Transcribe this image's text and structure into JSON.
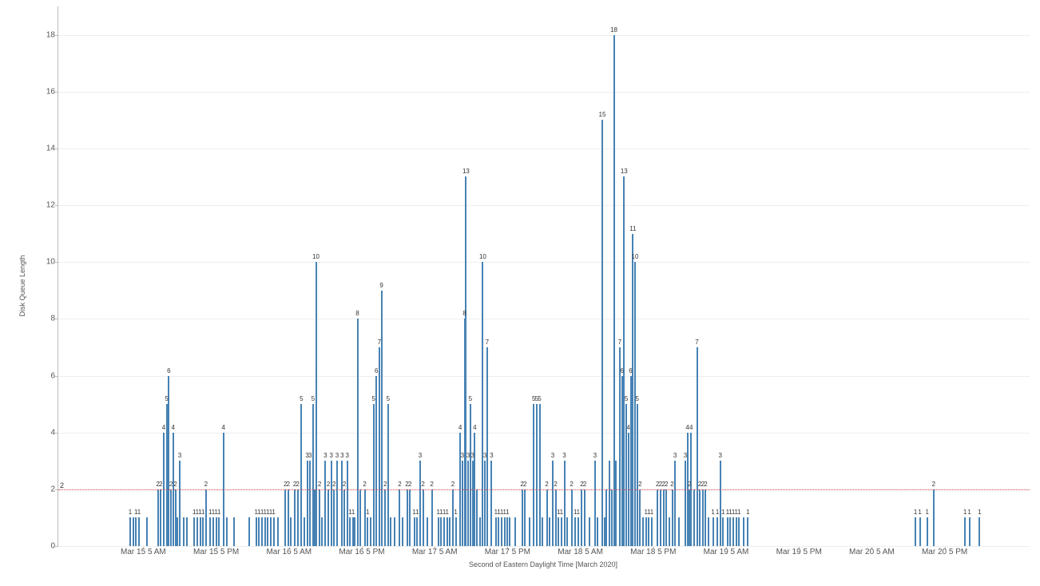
{
  "chart_data": {
    "type": "bar",
    "ylabel": "Disk Queue Length",
    "xlabel": "Second of Eastern Daylight Time [March 2020]",
    "ylim": [
      0,
      19
    ],
    "yticks": [
      0,
      2,
      4,
      6,
      8,
      10,
      12,
      14,
      16,
      18
    ],
    "x_categories": [
      "Mar 15 5 AM",
      "Mar 15 5 PM",
      "Mar 16 5 AM",
      "Mar 16 5 PM",
      "Mar 17 5 AM",
      "Mar 17 5 PM",
      "Mar 18 5 AM",
      "Mar 18 5 PM",
      "Mar 19 5 AM",
      "Mar 19 5 PM",
      "Mar 20 5 AM",
      "Mar 20 5 PM"
    ],
    "reference_line": {
      "y": 2,
      "label": "2"
    },
    "bars": [
      {
        "x": 0.32,
        "y": 1,
        "l": "1"
      },
      {
        "x": 0.36,
        "y": 1,
        "l": ""
      },
      {
        "x": 0.4,
        "y": 1,
        "l": "1"
      },
      {
        "x": 0.44,
        "y": 1,
        "l": "1"
      },
      {
        "x": 0.55,
        "y": 1,
        "l": ""
      },
      {
        "x": 0.7,
        "y": 2,
        "l": "2"
      },
      {
        "x": 0.74,
        "y": 2,
        "l": "2"
      },
      {
        "x": 0.78,
        "y": 4,
        "l": "4"
      },
      {
        "x": 0.82,
        "y": 5,
        "l": "5"
      },
      {
        "x": 0.85,
        "y": 6,
        "l": "6"
      },
      {
        "x": 0.88,
        "y": 2,
        "l": "2"
      },
      {
        "x": 0.91,
        "y": 4,
        "l": "4"
      },
      {
        "x": 0.94,
        "y": 2,
        "l": "2"
      },
      {
        "x": 0.97,
        "y": 1,
        "l": ""
      },
      {
        "x": 1.0,
        "y": 3,
        "l": "3"
      },
      {
        "x": 1.05,
        "y": 1,
        "l": ""
      },
      {
        "x": 1.1,
        "y": 1,
        "l": ""
      },
      {
        "x": 1.2,
        "y": 1,
        "l": "1"
      },
      {
        "x": 1.24,
        "y": 1,
        "l": "1"
      },
      {
        "x": 1.28,
        "y": 1,
        "l": "1"
      },
      {
        "x": 1.32,
        "y": 1,
        "l": "1"
      },
      {
        "x": 1.36,
        "y": 2,
        "l": "2"
      },
      {
        "x": 1.42,
        "y": 1,
        "l": "1"
      },
      {
        "x": 1.46,
        "y": 1,
        "l": "1"
      },
      {
        "x": 1.5,
        "y": 1,
        "l": "1"
      },
      {
        "x": 1.54,
        "y": 1,
        "l": "1"
      },
      {
        "x": 1.6,
        "y": 4,
        "l": "4"
      },
      {
        "x": 1.65,
        "y": 1,
        "l": ""
      },
      {
        "x": 1.75,
        "y": 1,
        "l": ""
      },
      {
        "x": 1.95,
        "y": 1,
        "l": ""
      },
      {
        "x": 2.05,
        "y": 1,
        "l": "1"
      },
      {
        "x": 2.09,
        "y": 1,
        "l": "1"
      },
      {
        "x": 2.13,
        "y": 1,
        "l": "1"
      },
      {
        "x": 2.17,
        "y": 1,
        "l": "1"
      },
      {
        "x": 2.21,
        "y": 1,
        "l": "1"
      },
      {
        "x": 2.25,
        "y": 1,
        "l": "1"
      },
      {
        "x": 2.29,
        "y": 1,
        "l": "1"
      },
      {
        "x": 2.35,
        "y": 1,
        "l": ""
      },
      {
        "x": 2.45,
        "y": 2,
        "l": "2"
      },
      {
        "x": 2.49,
        "y": 2,
        "l": "2"
      },
      {
        "x": 2.52,
        "y": 1,
        "l": ""
      },
      {
        "x": 2.58,
        "y": 2,
        "l": "2"
      },
      {
        "x": 2.62,
        "y": 2,
        "l": "2"
      },
      {
        "x": 2.67,
        "y": 5,
        "l": "5"
      },
      {
        "x": 2.71,
        "y": 1,
        "l": ""
      },
      {
        "x": 2.75,
        "y": 3,
        "l": "3"
      },
      {
        "x": 2.79,
        "y": 3,
        "l": "3"
      },
      {
        "x": 2.83,
        "y": 5,
        "l": "5"
      },
      {
        "x": 2.85,
        "y": 2,
        "l": ""
      },
      {
        "x": 2.87,
        "y": 10,
        "l": "10"
      },
      {
        "x": 2.92,
        "y": 2,
        "l": "2"
      },
      {
        "x": 2.95,
        "y": 1,
        "l": ""
      },
      {
        "x": 3.0,
        "y": 3,
        "l": "3"
      },
      {
        "x": 3.04,
        "y": 2,
        "l": "2"
      },
      {
        "x": 3.08,
        "y": 3,
        "l": "3"
      },
      {
        "x": 3.12,
        "y": 2,
        "l": "2"
      },
      {
        "x": 3.16,
        "y": 3,
        "l": "3"
      },
      {
        "x": 3.23,
        "y": 3,
        "l": "3"
      },
      {
        "x": 3.26,
        "y": 2,
        "l": "2"
      },
      {
        "x": 3.3,
        "y": 3,
        "l": "3"
      },
      {
        "x": 3.34,
        "y": 1,
        "l": "1"
      },
      {
        "x": 3.38,
        "y": 1,
        "l": "1"
      },
      {
        "x": 3.4,
        "y": 1,
        "l": ""
      },
      {
        "x": 3.44,
        "y": 8,
        "l": "8"
      },
      {
        "x": 3.48,
        "y": 2,
        "l": ""
      },
      {
        "x": 3.54,
        "y": 2,
        "l": "2"
      },
      {
        "x": 3.58,
        "y": 1,
        "l": "1"
      },
      {
        "x": 3.62,
        "y": 1,
        "l": ""
      },
      {
        "x": 3.66,
        "y": 5,
        "l": "5"
      },
      {
        "x": 3.7,
        "y": 6,
        "l": "6"
      },
      {
        "x": 3.74,
        "y": 7,
        "l": "7"
      },
      {
        "x": 3.77,
        "y": 9,
        "l": "9"
      },
      {
        "x": 3.82,
        "y": 2,
        "l": "2"
      },
      {
        "x": 3.86,
        "y": 5,
        "l": "5"
      },
      {
        "x": 3.9,
        "y": 1,
        "l": ""
      },
      {
        "x": 3.95,
        "y": 1,
        "l": ""
      },
      {
        "x": 4.02,
        "y": 2,
        "l": "2"
      },
      {
        "x": 4.06,
        "y": 1,
        "l": ""
      },
      {
        "x": 4.12,
        "y": 2,
        "l": "2"
      },
      {
        "x": 4.16,
        "y": 2,
        "l": "2"
      },
      {
        "x": 4.22,
        "y": 1,
        "l": "1"
      },
      {
        "x": 4.26,
        "y": 1,
        "l": "1"
      },
      {
        "x": 4.3,
        "y": 3,
        "l": "3"
      },
      {
        "x": 4.34,
        "y": 2,
        "l": "2"
      },
      {
        "x": 4.4,
        "y": 1,
        "l": ""
      },
      {
        "x": 4.46,
        "y": 2,
        "l": "2"
      },
      {
        "x": 4.55,
        "y": 1,
        "l": "1"
      },
      {
        "x": 4.59,
        "y": 1,
        "l": "1"
      },
      {
        "x": 4.63,
        "y": 1,
        "l": "1"
      },
      {
        "x": 4.67,
        "y": 1,
        "l": "1"
      },
      {
        "x": 4.71,
        "y": 1,
        "l": ""
      },
      {
        "x": 4.75,
        "y": 2,
        "l": "2"
      },
      {
        "x": 4.79,
        "y": 1,
        "l": "1"
      },
      {
        "x": 4.85,
        "y": 4,
        "l": "4"
      },
      {
        "x": 4.88,
        "y": 3,
        "l": "3"
      },
      {
        "x": 4.91,
        "y": 8,
        "l": "8"
      },
      {
        "x": 4.93,
        "y": 13,
        "l": "13"
      },
      {
        "x": 4.96,
        "y": 3,
        "l": "3"
      },
      {
        "x": 4.99,
        "y": 5,
        "l": "5"
      },
      {
        "x": 5.02,
        "y": 3,
        "l": "3"
      },
      {
        "x": 5.05,
        "y": 4,
        "l": "4"
      },
      {
        "x": 5.08,
        "y": 2,
        "l": ""
      },
      {
        "x": 5.12,
        "y": 1,
        "l": ""
      },
      {
        "x": 5.16,
        "y": 10,
        "l": "10"
      },
      {
        "x": 5.19,
        "y": 3,
        "l": "3"
      },
      {
        "x": 5.22,
        "y": 7,
        "l": "7"
      },
      {
        "x": 5.28,
        "y": 3,
        "l": "3"
      },
      {
        "x": 5.34,
        "y": 1,
        "l": "1"
      },
      {
        "x": 5.38,
        "y": 1,
        "l": "1"
      },
      {
        "x": 5.42,
        "y": 1,
        "l": "1"
      },
      {
        "x": 5.46,
        "y": 1,
        "l": "1"
      },
      {
        "x": 5.5,
        "y": 1,
        "l": "1"
      },
      {
        "x": 5.53,
        "y": 1,
        "l": ""
      },
      {
        "x": 5.6,
        "y": 1,
        "l": ""
      },
      {
        "x": 5.7,
        "y": 2,
        "l": "2"
      },
      {
        "x": 5.74,
        "y": 2,
        "l": "2"
      },
      {
        "x": 5.8,
        "y": 1,
        "l": ""
      },
      {
        "x": 5.86,
        "y": 5,
        "l": "5"
      },
      {
        "x": 5.9,
        "y": 5,
        "l": "5"
      },
      {
        "x": 5.94,
        "y": 5,
        "l": "5"
      },
      {
        "x": 5.98,
        "y": 1,
        "l": ""
      },
      {
        "x": 6.04,
        "y": 2,
        "l": "2"
      },
      {
        "x": 6.08,
        "y": 1,
        "l": ""
      },
      {
        "x": 6.12,
        "y": 3,
        "l": "3"
      },
      {
        "x": 6.16,
        "y": 2,
        "l": "2"
      },
      {
        "x": 6.2,
        "y": 1,
        "l": "1"
      },
      {
        "x": 6.24,
        "y": 1,
        "l": "1"
      },
      {
        "x": 6.28,
        "y": 3,
        "l": "3"
      },
      {
        "x": 6.32,
        "y": 1,
        "l": ""
      },
      {
        "x": 6.38,
        "y": 2,
        "l": "2"
      },
      {
        "x": 6.43,
        "y": 1,
        "l": "1"
      },
      {
        "x": 6.47,
        "y": 1,
        "l": "1"
      },
      {
        "x": 6.52,
        "y": 2,
        "l": "2"
      },
      {
        "x": 6.56,
        "y": 2,
        "l": "2"
      },
      {
        "x": 6.62,
        "y": 1,
        "l": ""
      },
      {
        "x": 6.7,
        "y": 3,
        "l": "3"
      },
      {
        "x": 6.74,
        "y": 1,
        "l": ""
      },
      {
        "x": 6.8,
        "y": 15,
        "l": "15"
      },
      {
        "x": 6.83,
        "y": 1,
        "l": ""
      },
      {
        "x": 6.86,
        "y": 2,
        "l": ""
      },
      {
        "x": 6.9,
        "y": 3,
        "l": ""
      },
      {
        "x": 6.93,
        "y": 2,
        "l": ""
      },
      {
        "x": 6.96,
        "y": 18,
        "l": "18"
      },
      {
        "x": 6.99,
        "y": 3,
        "l": ""
      },
      {
        "x": 7.04,
        "y": 7,
        "l": "7"
      },
      {
        "x": 7.07,
        "y": 6,
        "l": "6"
      },
      {
        "x": 7.1,
        "y": 13,
        "l": "13"
      },
      {
        "x": 7.13,
        "y": 5,
        "l": "5"
      },
      {
        "x": 7.16,
        "y": 4,
        "l": "4"
      },
      {
        "x": 7.19,
        "y": 6,
        "l": "6"
      },
      {
        "x": 7.22,
        "y": 11,
        "l": "11"
      },
      {
        "x": 7.25,
        "y": 10,
        "l": "10"
      },
      {
        "x": 7.28,
        "y": 5,
        "l": "5"
      },
      {
        "x": 7.32,
        "y": 2,
        "l": "2"
      },
      {
        "x": 7.36,
        "y": 1,
        "l": ""
      },
      {
        "x": 7.4,
        "y": 1,
        "l": "1"
      },
      {
        "x": 7.44,
        "y": 1,
        "l": "1"
      },
      {
        "x": 7.48,
        "y": 1,
        "l": "1"
      },
      {
        "x": 7.56,
        "y": 2,
        "l": "2"
      },
      {
        "x": 7.6,
        "y": 2,
        "l": "2"
      },
      {
        "x": 7.64,
        "y": 2,
        "l": "2"
      },
      {
        "x": 7.68,
        "y": 2,
        "l": "2"
      },
      {
        "x": 7.72,
        "y": 1,
        "l": ""
      },
      {
        "x": 7.76,
        "y": 2,
        "l": "2"
      },
      {
        "x": 7.8,
        "y": 3,
        "l": "3"
      },
      {
        "x": 7.85,
        "y": 1,
        "l": ""
      },
      {
        "x": 7.94,
        "y": 3,
        "l": "3"
      },
      {
        "x": 7.97,
        "y": 4,
        "l": "4"
      },
      {
        "x": 8.0,
        "y": 2,
        "l": "2"
      },
      {
        "x": 8.02,
        "y": 4,
        "l": "4"
      },
      {
        "x": 8.06,
        "y": 2,
        "l": ""
      },
      {
        "x": 8.1,
        "y": 7,
        "l": "7"
      },
      {
        "x": 8.14,
        "y": 2,
        "l": "2"
      },
      {
        "x": 8.18,
        "y": 2,
        "l": "2"
      },
      {
        "x": 8.22,
        "y": 2,
        "l": "2"
      },
      {
        "x": 8.26,
        "y": 1,
        "l": ""
      },
      {
        "x": 8.32,
        "y": 1,
        "l": "1"
      },
      {
        "x": 8.38,
        "y": 1,
        "l": "1"
      },
      {
        "x": 8.42,
        "y": 3,
        "l": "3"
      },
      {
        "x": 8.46,
        "y": 1,
        "l": "1"
      },
      {
        "x": 8.52,
        "y": 1,
        "l": "1"
      },
      {
        "x": 8.56,
        "y": 1,
        "l": "1"
      },
      {
        "x": 8.6,
        "y": 1,
        "l": "1"
      },
      {
        "x": 8.64,
        "y": 1,
        "l": "1"
      },
      {
        "x": 8.68,
        "y": 1,
        "l": "1"
      },
      {
        "x": 8.74,
        "y": 1,
        "l": ""
      },
      {
        "x": 8.8,
        "y": 1,
        "l": "1"
      },
      {
        "x": 11.1,
        "y": 1,
        "l": "1"
      },
      {
        "x": 11.16,
        "y": 1,
        "l": "1"
      },
      {
        "x": 11.26,
        "y": 1,
        "l": "1"
      },
      {
        "x": 11.35,
        "y": 2,
        "l": "2"
      },
      {
        "x": 11.78,
        "y": 1,
        "l": "1"
      },
      {
        "x": 11.84,
        "y": 1,
        "l": "1"
      },
      {
        "x": 11.98,
        "y": 1,
        "l": "1"
      }
    ]
  }
}
